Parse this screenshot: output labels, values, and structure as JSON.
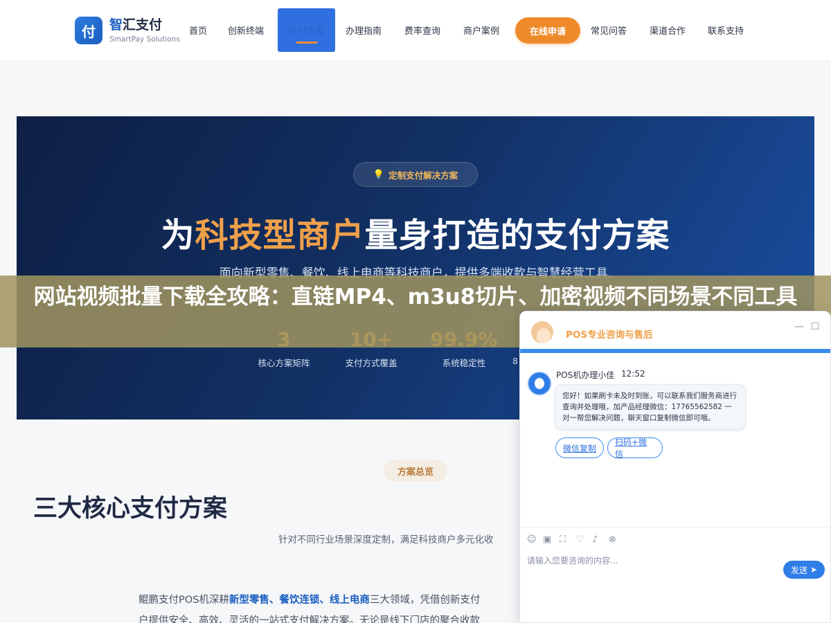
{
  "header": {
    "logo_mark": "付",
    "logo_name_a": "智",
    "logo_name_b": "汇支付",
    "logo_sub": "SmartPay Solutions",
    "nav": [
      "首页",
      "创新终端",
      "支付方案",
      "办理指南",
      "费率查询",
      "商户案例",
      "在线申请",
      "常见问答",
      "渠道合作",
      "联系支持"
    ]
  },
  "hero": {
    "tag": "定制支付解决方案",
    "title_a": "为",
    "title_hl": "科技型商户",
    "title_b": "量身打造的支付方案",
    "subtitle": "面向新型零售、餐饮、线上电商等科技商户，提供多端收款与智慧经营工具,",
    "stats": [
      {
        "num": "3",
        "label": "核心方案矩阵"
      },
      {
        "num": "10+",
        "label": "支付方式覆盖"
      },
      {
        "num": "99.9%",
        "label": "系统稳定性"
      },
      {
        "num": "8",
        "label": ""
      }
    ]
  },
  "banner": {
    "title": "网站视频批量下载全攻略：直链MP4、m3u8切片、加密视频不同场景不同工具"
  },
  "section": {
    "pill": "方案总览",
    "title": "三大核心支付方案",
    "desc": "针对不同行业场景深度定制，满足科技商户多元化收",
    "body_a": "鲲鹏支付POS机深耕",
    "body_hl": "新型零售、餐饮连锁、线上电商",
    "body_b": "三大领域，凭借创新支付",
    "body_line2": "户提供安全、高效、灵活的一站式支付解决方案。无论是线下门店的聚合收款"
  },
  "chat": {
    "title": "POS专业咨询与售后",
    "agent_name": "POS机办理小佳",
    "agent_time": "12:52",
    "message": "您好！如果刷卡未及时到账，可以联系我们服务商进行查询并处理哦，加产品经理微信：17765562582 一对一帮您解决问题，聊天窗口复制微信即可哦。",
    "quick_buttons": [
      "微信复制",
      "扫码+微信"
    ],
    "input_placeholder": "请输入您要咨询的内容...",
    "send_label": "发送",
    "minimize": "—",
    "maximize": "☐"
  }
}
